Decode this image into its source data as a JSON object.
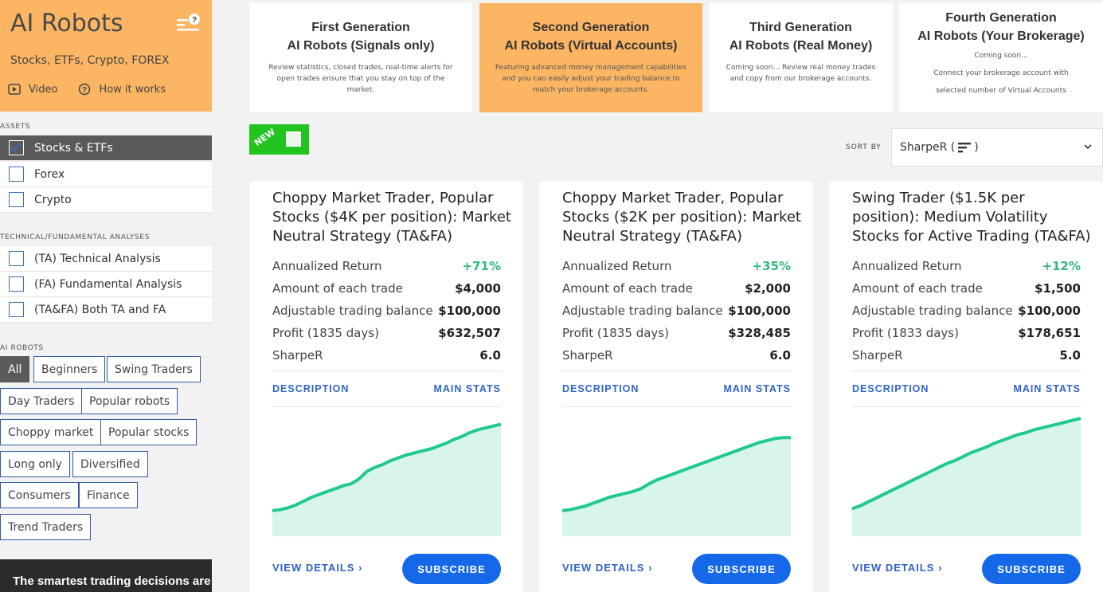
{
  "sidebar": {
    "brand_title": "AI Robots",
    "brand_subtitle": "Stocks, ETFs, Crypto, FOREX",
    "video_label": "Video",
    "how_label": "How it works",
    "assets_label": "ASSETS",
    "assets": [
      {
        "label": "Stocks & ETFs",
        "checked": true
      },
      {
        "label": "Forex",
        "checked": false
      },
      {
        "label": "Crypto",
        "checked": false
      }
    ],
    "analyses_label": "TECHNICAL/FUNDAMENTAL ANALYSES",
    "analyses": [
      {
        "label": "(TA) Technical Analysis",
        "checked": false
      },
      {
        "label": "(FA) Fundamental Analysis",
        "checked": false
      },
      {
        "label": "(TA&FA) Both TA and FA",
        "checked": false
      }
    ],
    "robots_label": "AI ROBOTS",
    "tags": [
      "All",
      "Beginners",
      "Swing Traders",
      "Day Traders",
      "Popular robots",
      "Choppy market",
      "Popular stocks",
      "Long only",
      "Diversified",
      "Consumers",
      "Finance",
      "Trend Traders"
    ],
    "active_tag": "All",
    "promo_text": "The smartest trading decisions are"
  },
  "generations": [
    {
      "title_line1": "First Generation",
      "title_line2": "AI Robots (Signals only)",
      "desc": "Review statistics, closed trades, real-time alerts for open trades ensure that you stay on top of the market."
    },
    {
      "title_line1": "Second Generation",
      "title_line2": "AI Robots (Virtual Accounts)",
      "desc": "Featuring advanced money management capabilities and you can easily adjust your trading balance to match your brokerage accounts."
    },
    {
      "title_line1": "Third Generation",
      "title_line2": "AI Robots (Real Money)",
      "desc": "Coming soon... Review real money trades and copy from our brokerage accounts."
    },
    {
      "title_line1": "Fourth Generation",
      "title_line2": "AI Robots (Your Brokerage)",
      "desc_line1": "Coming soon...",
      "desc_line2": "Connect your brokerage account with",
      "desc_line3": "selected number of Virtual Accounts"
    }
  ],
  "new_badge": "NEW",
  "sort": {
    "label": "SORT BY",
    "value": "SharpeR (",
    "value_suffix": ")"
  },
  "colors": {
    "accent_orange": "#fbb563",
    "positive_green": "#2dbb7a",
    "link_blue": "#2f63c8",
    "button_blue": "#1569e8",
    "chart_line": "#1fca8a",
    "chart_fill": "#d8f5ea"
  },
  "cards": [
    {
      "title": "Choppy Market Trader, Popular Stocks ($4K per position): Market Neutral Strategy (TA&FA)",
      "stats": [
        {
          "label": "Annualized Return",
          "value": "+71%"
        },
        {
          "label": "Amount of each trade",
          "value": "$4,000"
        },
        {
          "label": "Adjustable trading balance",
          "value": "$100,000"
        },
        {
          "label": "Profit (1835 days)",
          "value": "$632,507"
        },
        {
          "label": "SharpeR",
          "value": "6.0"
        }
      ],
      "tab_description": "DESCRIPTION",
      "tab_main_stats": "MAIN STATS",
      "view_details": "VIEW DETAILS  ›",
      "subscribe": "SUBSCRIBE",
      "spark": [
        0.1,
        0.11,
        0.13,
        0.16,
        0.2,
        0.24,
        0.27,
        0.3,
        0.33,
        0.36,
        0.38,
        0.43,
        0.51,
        0.55,
        0.58,
        0.62,
        0.65,
        0.68,
        0.7,
        0.72,
        0.74,
        0.77,
        0.8,
        0.84,
        0.87,
        0.91,
        0.94,
        0.96,
        0.98,
        1.0
      ]
    },
    {
      "title": "Choppy Market Trader, Popular Stocks ($2K per position): Market Neutral Strategy (TA&FA)",
      "stats": [
        {
          "label": "Annualized Return",
          "value": "+35%"
        },
        {
          "label": "Amount of each trade",
          "value": "$2,000"
        },
        {
          "label": "Adjustable trading balance",
          "value": "$100,000"
        },
        {
          "label": "Profit (1835 days)",
          "value": "$328,485"
        },
        {
          "label": "SharpeR",
          "value": "6.0"
        }
      ],
      "tab_description": "DESCRIPTION",
      "tab_main_stats": "MAIN STATS",
      "view_details": "VIEW DETAILS  ›",
      "subscribe": "SUBSCRIBE",
      "spark": [
        0.1,
        0.11,
        0.13,
        0.15,
        0.18,
        0.21,
        0.24,
        0.26,
        0.28,
        0.3,
        0.33,
        0.38,
        0.42,
        0.45,
        0.48,
        0.51,
        0.54,
        0.57,
        0.6,
        0.63,
        0.66,
        0.69,
        0.72,
        0.75,
        0.78,
        0.81,
        0.83,
        0.85,
        0.86,
        0.86
      ]
    },
    {
      "title": "Swing Trader ($1.5K per position): Medium Volatility Stocks for Active Trading (TA&FA)",
      "stats": [
        {
          "label": "Annualized Return",
          "value": "+12%"
        },
        {
          "label": "Amount of each trade",
          "value": "$1,500"
        },
        {
          "label": "Adjustable trading balance",
          "value": "$100,000"
        },
        {
          "label": "Profit (1833 days)",
          "value": "$178,651"
        },
        {
          "label": "SharpeR",
          "value": "5.0"
        }
      ],
      "tab_description": "DESCRIPTION",
      "tab_main_stats": "MAIN STATS",
      "view_details": "VIEW DETAILS  ›",
      "subscribe": "SUBSCRIBE",
      "spark": [
        0.12,
        0.15,
        0.19,
        0.23,
        0.27,
        0.31,
        0.35,
        0.39,
        0.43,
        0.47,
        0.51,
        0.55,
        0.59,
        0.62,
        0.66,
        0.7,
        0.73,
        0.76,
        0.8,
        0.83,
        0.86,
        0.89,
        0.91,
        0.94,
        0.96,
        0.98,
        1.0,
        1.02,
        1.04,
        1.06
      ]
    }
  ]
}
